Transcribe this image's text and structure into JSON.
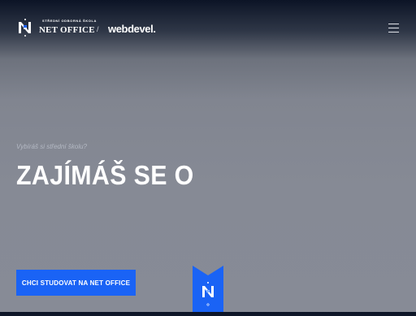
{
  "header": {
    "logo": {
      "small_text": "STŘEDNÍ ODBORNÁ ŠKOLA",
      "name": "NET OFFICE",
      "mark_letter": "N"
    },
    "divider": "/",
    "partner": "webdevel.",
    "menu_icon": "hamburger-icon"
  },
  "hero": {
    "eyebrow": "Vybíráš si střední školu?",
    "headline": "ZAJÍMÁŠ SE O",
    "cta_label": "CHCI STUDOVAT NA NET OFFICE",
    "badge_icon": "school-crest-icon"
  },
  "colors": {
    "accent": "#1a63f5",
    "header_dark": "#0c1426",
    "background": "#878b96"
  }
}
